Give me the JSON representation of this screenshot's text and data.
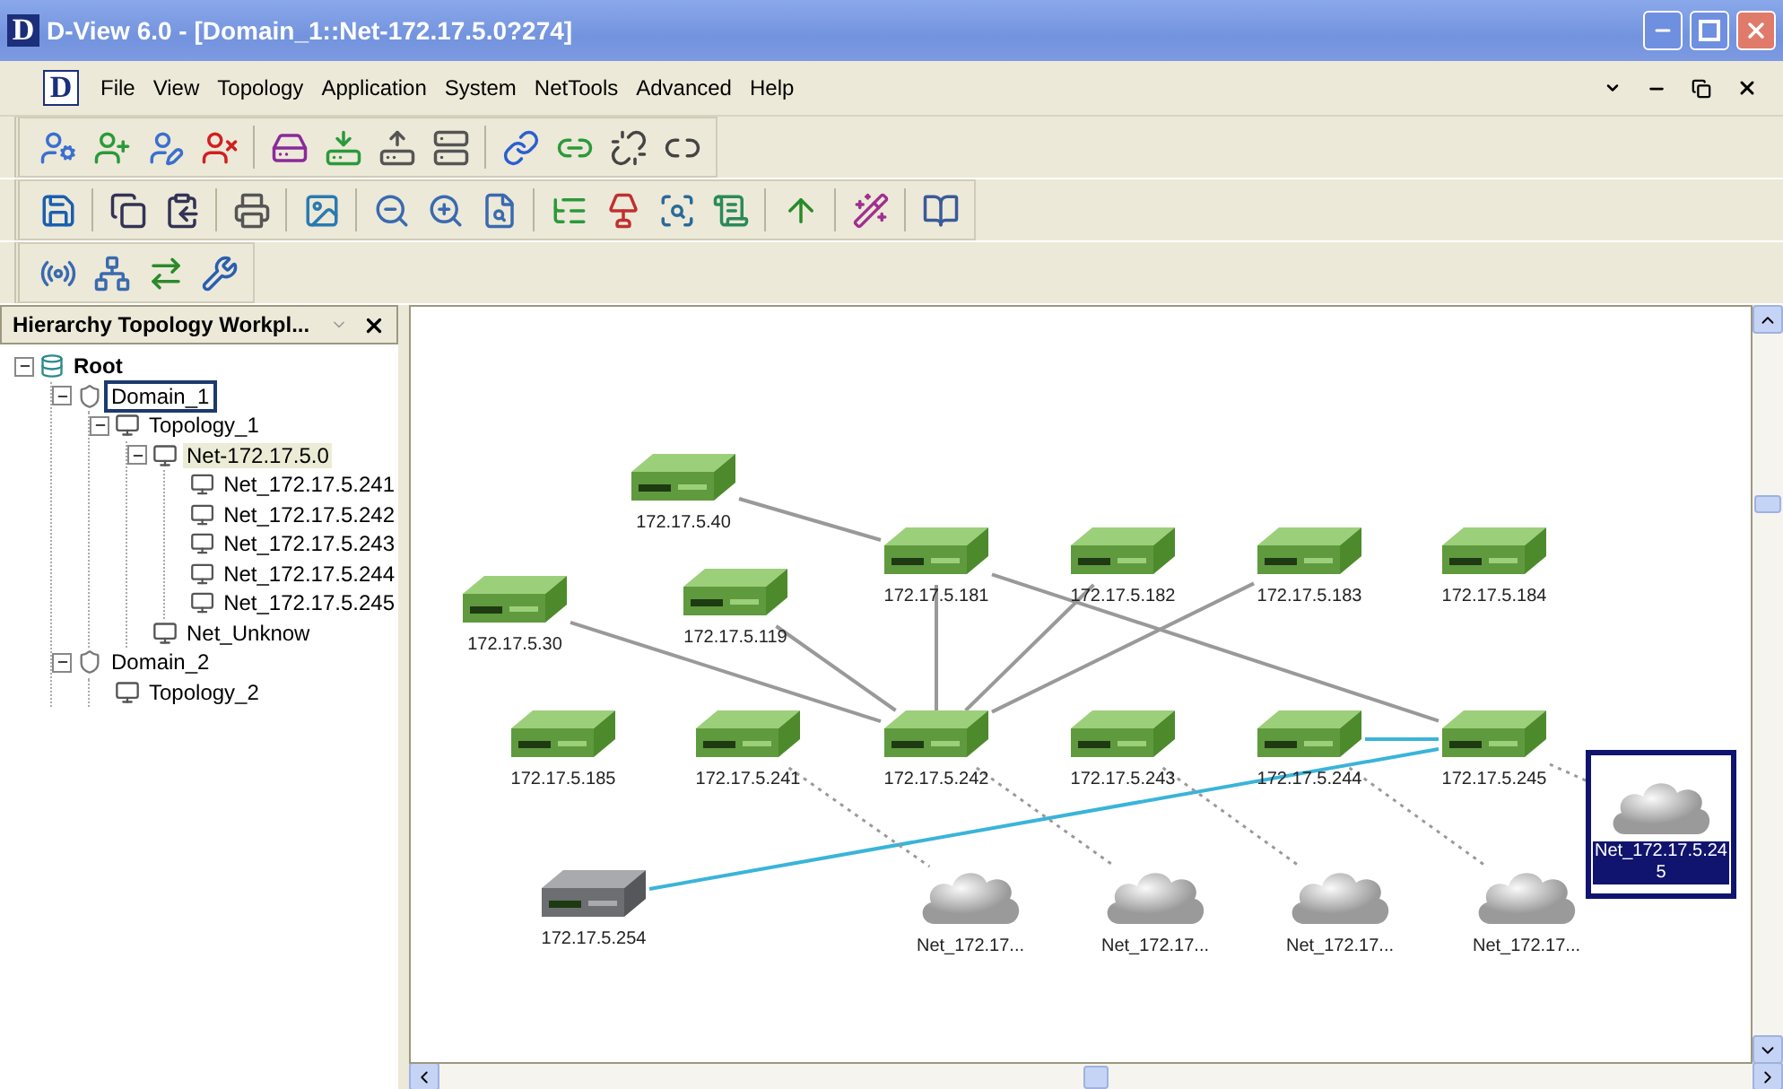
{
  "window": {
    "logo": "D",
    "title": "D-View 6.0 - [Domain_1::Net-172.17.5.0?274]"
  },
  "menu_bar": {
    "logo": "D",
    "items": [
      "File",
      "View",
      "Topology",
      "Application",
      "System",
      "NetTools",
      "Advanced",
      "Help"
    ]
  },
  "workplace_panel": {
    "title": "Hierarchy Topology Workpl...",
    "tree": [
      {
        "label": "Root",
        "kind": "root",
        "expanded": true,
        "selected": false,
        "highlighted": false,
        "children": [
          {
            "label": "Domain_1",
            "kind": "domain",
            "expanded": true,
            "selected": true,
            "highlighted": false,
            "children": [
              {
                "label": "Topology_1",
                "kind": "topology",
                "expanded": true,
                "selected": false,
                "highlighted": false,
                "children": [
                  {
                    "label": "Net-172.17.5.0",
                    "kind": "topology",
                    "expanded": true,
                    "selected": false,
                    "highlighted": true,
                    "children": [
                      {
                        "label": "Net_172.17.5.241",
                        "kind": "topology",
                        "selected": false,
                        "highlighted": false
                      },
                      {
                        "label": "Net_172.17.5.242",
                        "kind": "topology",
                        "selected": false,
                        "highlighted": false
                      },
                      {
                        "label": "Net_172.17.5.243",
                        "kind": "topology",
                        "selected": false,
                        "highlighted": false
                      },
                      {
                        "label": "Net_172.17.5.244",
                        "kind": "topology",
                        "selected": false,
                        "highlighted": false
                      },
                      {
                        "label": "Net_172.17.5.245",
                        "kind": "topology",
                        "selected": false,
                        "highlighted": false
                      }
                    ]
                  },
                  {
                    "label": "Net_Unknow",
                    "kind": "topology",
                    "selected": false,
                    "highlighted": false
                  }
                ]
              }
            ]
          },
          {
            "label": "Domain_2",
            "kind": "domain",
            "expanded": true,
            "selected": false,
            "highlighted": false,
            "children": [
              {
                "label": "Topology_2",
                "kind": "topology",
                "selected": false,
                "highlighted": false
              }
            ]
          }
        ]
      }
    ]
  },
  "topology": {
    "nodes": [
      {
        "label": "172.17.5.40",
        "kind": "switch",
        "selected": false
      },
      {
        "label": "172.17.5.181",
        "kind": "switch",
        "selected": false
      },
      {
        "label": "172.17.5.182",
        "kind": "switch",
        "selected": false
      },
      {
        "label": "172.17.5.183",
        "kind": "switch",
        "selected": false
      },
      {
        "label": "172.17.5.184",
        "kind": "switch",
        "selected": false
      },
      {
        "label": "172.17.5.30",
        "kind": "switch",
        "selected": false
      },
      {
        "label": "172.17.5.119",
        "kind": "switch",
        "selected": false
      },
      {
        "label": "172.17.5.185",
        "kind": "switch",
        "selected": false
      },
      {
        "label": "172.17.5.241",
        "kind": "switch",
        "selected": false
      },
      {
        "label": "172.17.5.242",
        "kind": "switch",
        "selected": false
      },
      {
        "label": "172.17.5.243",
        "kind": "switch",
        "selected": false
      },
      {
        "label": "172.17.5.244",
        "kind": "switch",
        "selected": false
      },
      {
        "label": "172.17.5.245",
        "kind": "switch",
        "selected": false
      },
      {
        "label": "172.17.5.254",
        "kind": "device",
        "selected": false
      },
      {
        "label": "Net_172.17...",
        "kind": "cloud",
        "selected": false
      },
      {
        "label": "Net_172.17...",
        "kind": "cloud",
        "selected": false
      },
      {
        "label": "Net_172.17...",
        "kind": "cloud",
        "selected": false
      },
      {
        "label": "Net_172.17...",
        "kind": "cloud",
        "selected": false
      },
      {
        "label": "Net_172.17.5.245",
        "kind": "cloud",
        "selected": true
      }
    ]
  }
}
